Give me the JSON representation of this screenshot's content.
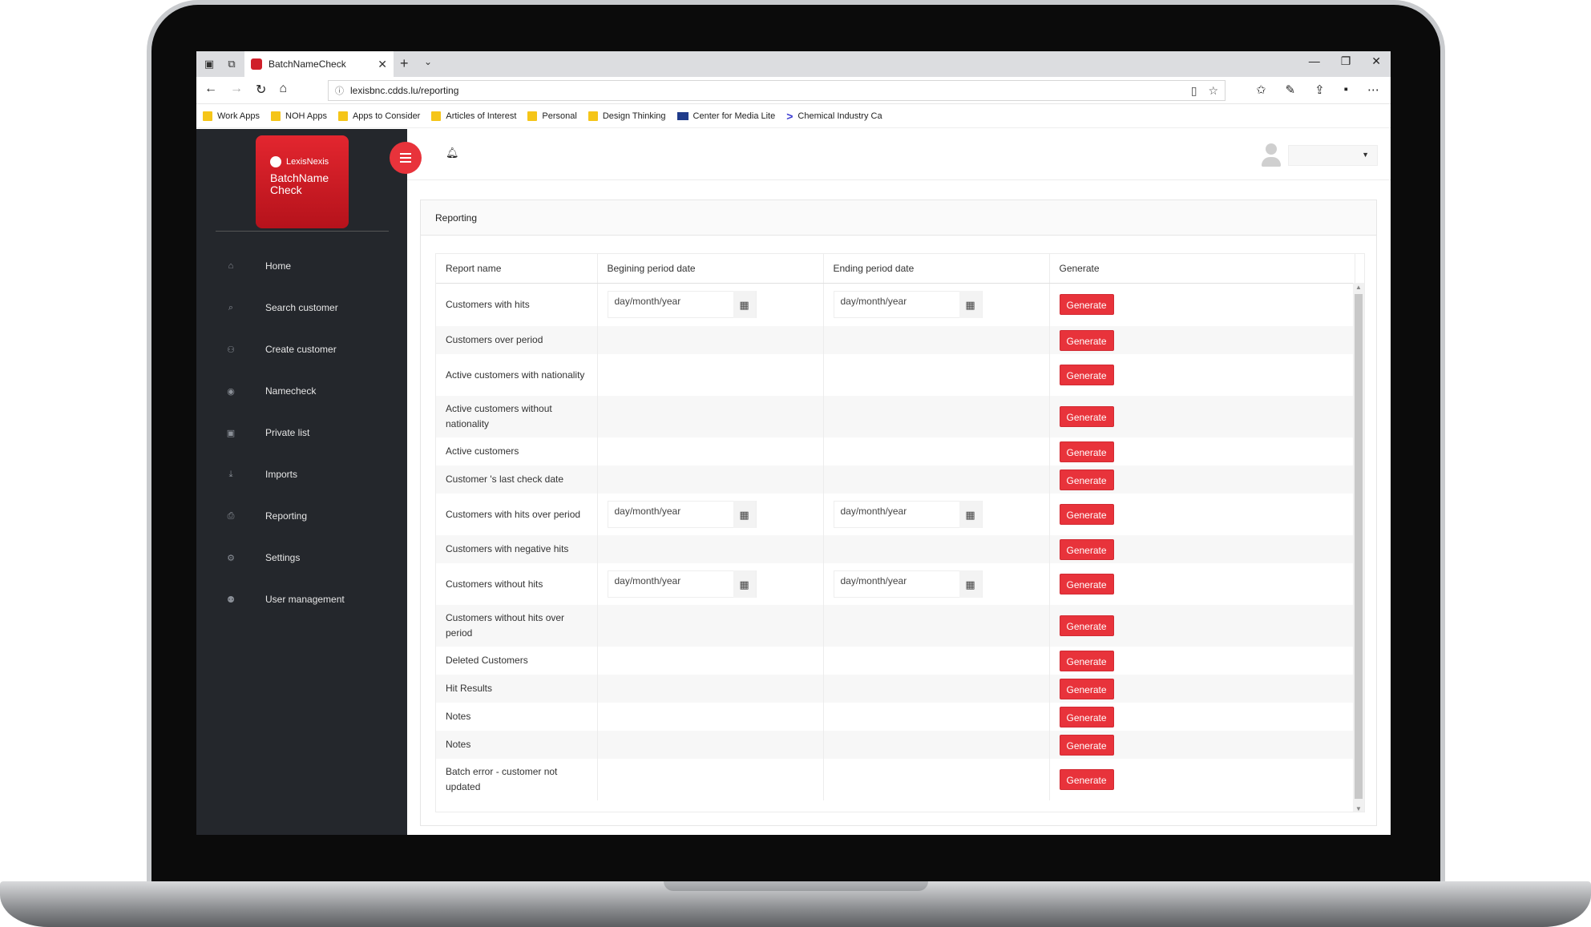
{
  "browser": {
    "tab_title": "BatchNameCheck",
    "tab_close": "✕",
    "new_tab": "+",
    "tab_list": "⌄",
    "url": "lexisbnc.cdds.lu/reporting",
    "window_controls": [
      "—",
      "❐",
      "✕"
    ],
    "bookmarks": [
      {
        "label": "Work Apps",
        "icon": "folder-icon"
      },
      {
        "label": "NOH Apps",
        "icon": "folder-icon"
      },
      {
        "label": "Apps to Consider",
        "icon": "folder-icon"
      },
      {
        "label": "Articles of Interest",
        "icon": "folder-icon"
      },
      {
        "label": "Personal",
        "icon": "folder-icon"
      },
      {
        "label": "Design Thinking",
        "icon": "folder-icon"
      },
      {
        "label": "Center for Media Lite",
        "icon": "media-icon"
      },
      {
        "label": "Chemical Industry Ca",
        "icon": "chevron-icon"
      }
    ]
  },
  "logo": {
    "brand": "LexisNexis",
    "product": "BatchName Check"
  },
  "sidebar": {
    "items": [
      {
        "label": "Home",
        "icon": "home-icon"
      },
      {
        "label": "Search customer",
        "icon": "search-icon"
      },
      {
        "label": "Create customer",
        "icon": "add-user-icon"
      },
      {
        "label": "Namecheck",
        "icon": "eye-icon"
      },
      {
        "label": "Private list",
        "icon": "archive-icon"
      },
      {
        "label": "Imports",
        "icon": "download-icon"
      },
      {
        "label": "Reporting",
        "icon": "print-icon"
      },
      {
        "label": "Settings",
        "icon": "gear-icon"
      },
      {
        "label": "User management",
        "icon": "users-icon"
      }
    ]
  },
  "card": {
    "title": "Reporting"
  },
  "table": {
    "columns": [
      "Report name",
      "Begining period date",
      "Ending period date",
      "Generate"
    ],
    "date_placeholder": "day/month/year",
    "button_label": "Generate",
    "rows": [
      {
        "name": "Customers with hits",
        "dates": true
      },
      {
        "name": "Customers over period",
        "dates": false
      },
      {
        "name": "Active customers with nationality",
        "dates": false
      },
      {
        "name": "Active customers without nationality",
        "dates": false
      },
      {
        "name": "Active customers",
        "dates": false
      },
      {
        "name": "Customer 's last check date",
        "dates": false
      },
      {
        "name": "Customers with hits over period",
        "dates": true
      },
      {
        "name": "Customers with negative hits",
        "dates": false
      },
      {
        "name": "Customers without hits",
        "dates": true
      },
      {
        "name": "Customers without hits over period",
        "dates": false
      },
      {
        "name": "Deleted Customers",
        "dates": false
      },
      {
        "name": "Hit Results",
        "dates": false
      },
      {
        "name": "Notes",
        "dates": false
      },
      {
        "name": "Notes",
        "dates": false
      },
      {
        "name": "Batch error - customer not updated",
        "dates": false
      }
    ]
  },
  "colors": {
    "accent": "#e8333b",
    "sidebar_bg": "#24272c"
  }
}
